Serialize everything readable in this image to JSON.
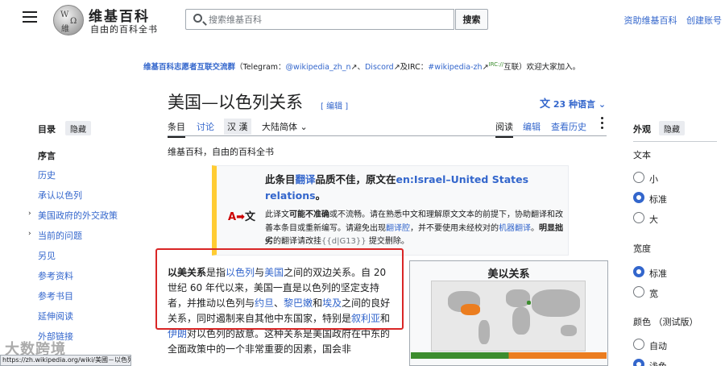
{
  "header": {
    "logo_main": "维基百科",
    "logo_sub": "自由的百科全书",
    "search_placeholder": "搜索维基百科",
    "search_button": "搜索",
    "links": [
      "资助维基百科",
      "创建账号"
    ]
  },
  "sitenotice": {
    "group": "维基百科志愿者互联交流群",
    "p1": "（Telegram：",
    "tg": "@wikipedia_zh_n",
    "p2": "、",
    "discord": "Discord",
    "p3": "及IRC：",
    "irc": "#wikipedia-zh",
    "irc_tag": "IRC://",
    "p4": "互联）欢迎大家加入。"
  },
  "article": {
    "title": "美国—以色列关系",
    "edit_link": "[ 编辑 ]",
    "languages": "23 种语言",
    "from": "维基百科，自由的百科全书"
  },
  "tabs": {
    "article": "条目",
    "talk": "讨论",
    "zh_hans": "汉",
    "zh_hant": "漢",
    "variant": "大陆简体",
    "read": "阅读",
    "edit": "编辑",
    "history": "查看历史"
  },
  "toc": {
    "title": "目录",
    "hide": "隐藏",
    "items": [
      "序言",
      "历史",
      "承认以色列",
      "美国政府的外交政策",
      "当前的问题",
      "另见",
      "参考资料",
      "参考书目",
      "延伸阅读",
      "外部链接"
    ]
  },
  "appearance": {
    "title": "外观",
    "hide": "隐藏",
    "text_label": "文本",
    "text_options": [
      "小",
      "标准",
      "大"
    ],
    "width_label": "宽度",
    "width_options": [
      "标准",
      "宽"
    ],
    "color_label": "颜色  （测试版）",
    "color_options": [
      "自动",
      "浅色"
    ]
  },
  "ambox": {
    "icon_a": "A",
    "icon_b": "文",
    "t1a": "此条目",
    "t1b": "翻译",
    "t1c": "品质不佳，原文在",
    "t1d": "en:Israel–United States relations",
    "t1e": "。",
    "t2a": "此译文",
    "t2b": "可能不准确",
    "t2c": "或不流畅。请在熟悉中文和理解原文文本的前提下，协助翻译和改善本条目或重新编写。请避免出现",
    "t2d": "翻译腔",
    "t2e": "，并不要使用未经校对的",
    "t2f": "机器翻译",
    "t2g": "。",
    "t2h": "明显拙劣",
    "t2i": "的翻译请改挂",
    "t2j": "{{d|G13}}",
    "t2k": " 提交删除。"
  },
  "intro": {
    "b": "以美关系",
    "s1": "是指",
    "l1": "以色列",
    "s2": "与",
    "l2": "美国",
    "s3": "之间的双边关系。自 20 世纪 60 年代以来，美国一直是以色列的坚定支持者，并推动以色列与",
    "l3": "约旦",
    "s4": "、",
    "l4": "黎巴嫩",
    "s5": "和",
    "l5": "埃及",
    "s6": "之间的良好关系，同时遏制来自其他中东国家，特别是",
    "l6": "叙利亚",
    "s7": "和",
    "l7": "伊朗",
    "s8": "对以色列的敌意。这种关系是美国政府在中东的全面政策中的一个非常重要的因素，国会非"
  },
  "infobox": {
    "title": "美以关系"
  },
  "watermark": "大数跨境",
  "status_url": "https://zh.wikipedia.org/wiki/美國－以色列關係#"
}
